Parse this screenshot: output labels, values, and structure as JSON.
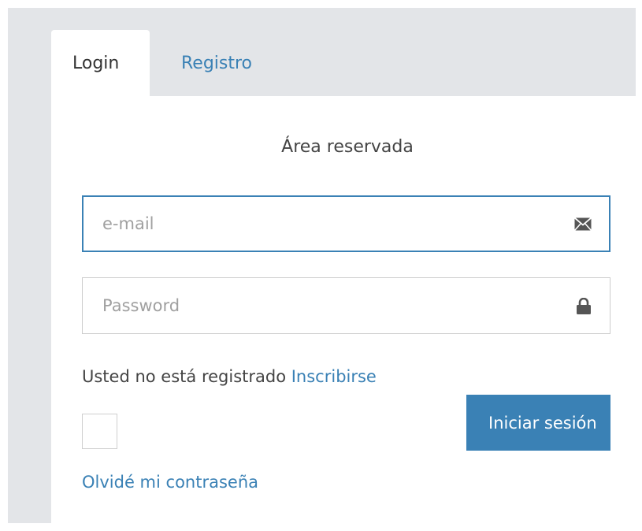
{
  "tabs": [
    {
      "label": "Login",
      "active": true
    },
    {
      "label": "Registro",
      "active": false
    }
  ],
  "panel": {
    "title": "Área reservada"
  },
  "email_field": {
    "value": "",
    "placeholder": "e-mail",
    "icon": "envelope-icon"
  },
  "password_field": {
    "value": "",
    "placeholder": "Password",
    "icon": "lock-icon"
  },
  "register_prompt": {
    "text": "Usted no está registrado ",
    "link_label": "Inscribirse"
  },
  "remember_checkbox": {
    "checked": false
  },
  "submit_button": {
    "label": "Iniciar sesión"
  },
  "forgot_link": {
    "label": "Olvidé mi contraseña"
  },
  "colors": {
    "accent": "#3a81b5",
    "background": "#e3e5e8",
    "panel": "#ffffff",
    "text": "#444444"
  }
}
